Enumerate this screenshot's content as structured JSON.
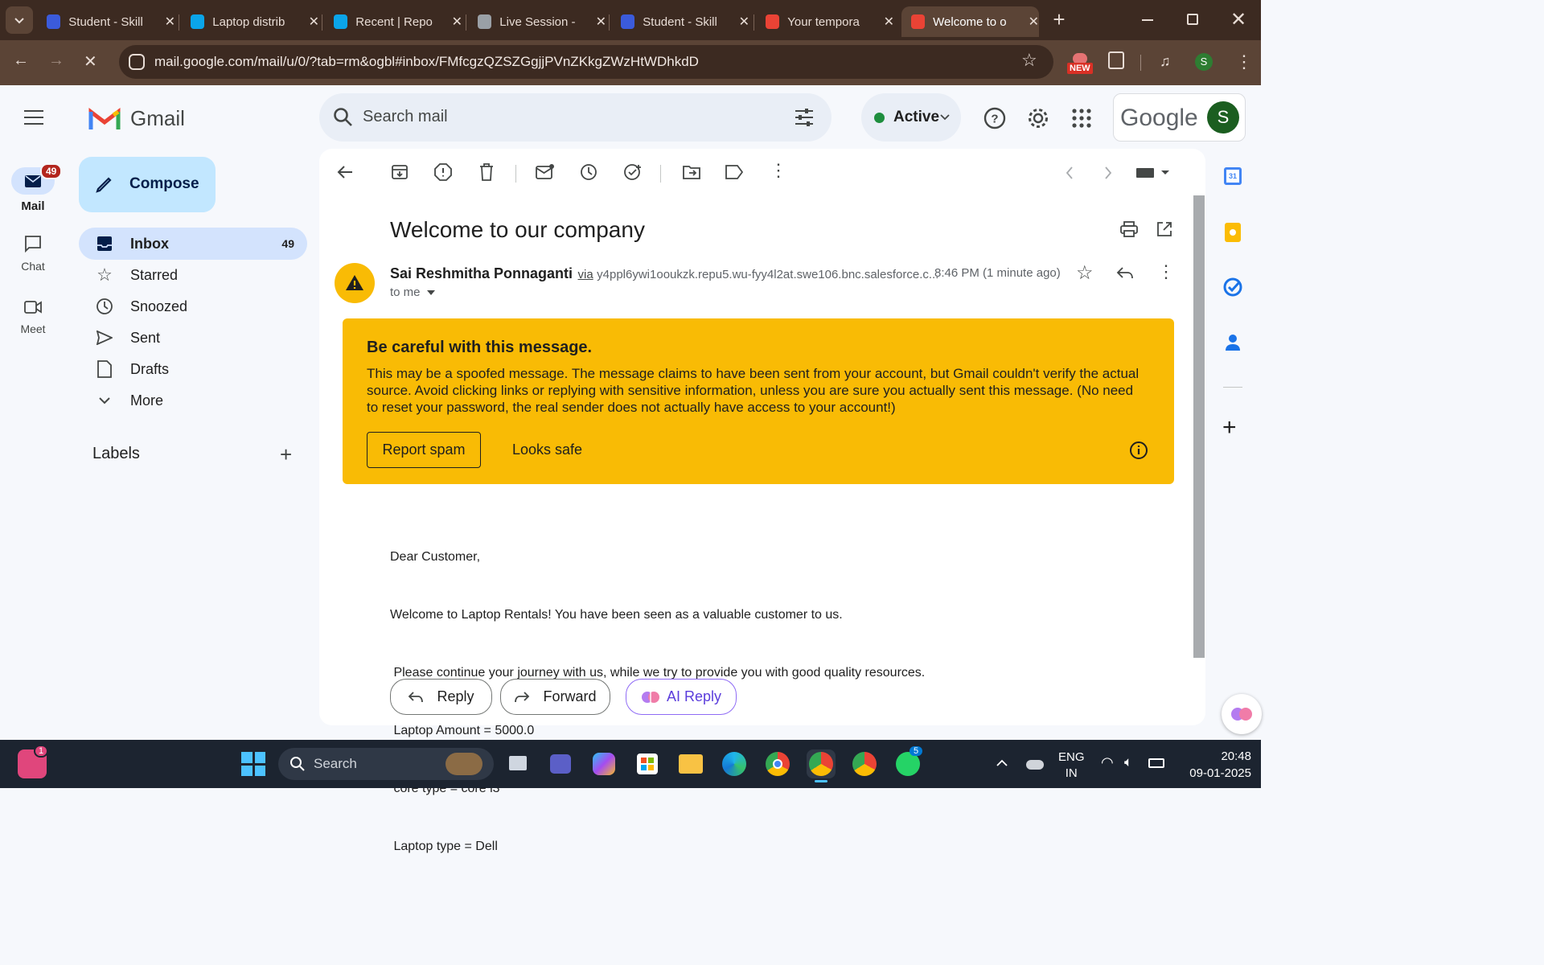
{
  "browser": {
    "tabs": [
      {
        "title": "Student - Skill",
        "color": "#3b5bdb"
      },
      {
        "title": "Laptop distrib",
        "color": "#0ba5e9"
      },
      {
        "title": "Recent | Repo",
        "color": "#0ba5e9"
      },
      {
        "title": "Live Session -",
        "color": "#9aa0a6"
      },
      {
        "title": "Student - Skill",
        "color": "#3b5bdb"
      },
      {
        "title": "Your tempora",
        "color": "#ea4335"
      },
      {
        "title": "Welcome to o",
        "color": "#ea4335"
      }
    ],
    "url": "mail.google.com/mail/u/0/?tab=rm&ogbl#inbox/FMfcgzQZSZGgjjPVnZKkgZWzHtWDhkdD",
    "ext_badge": "NEW",
    "profile_initial": "S"
  },
  "gmail": {
    "logo_text": "Gmail",
    "search_placeholder": "Search mail",
    "status": "Active",
    "google_text": "Google",
    "avatar_initial": "S",
    "rail": [
      {
        "label": "Mail",
        "badge": "49"
      },
      {
        "label": "Chat"
      },
      {
        "label": "Meet"
      }
    ],
    "compose": "Compose",
    "nav": [
      {
        "label": "Inbox",
        "count": "49"
      },
      {
        "label": "Starred"
      },
      {
        "label": "Snoozed"
      },
      {
        "label": "Sent"
      },
      {
        "label": "Drafts"
      },
      {
        "label": "More"
      }
    ],
    "labels_heading": "Labels"
  },
  "email": {
    "subject": "Welcome to our company",
    "sender": "Sai Reshmitha Ponnaganti",
    "via": "via",
    "via_address": "y4ppl6ywi1ooukzk.repu5.wu-fyy4l2at.swe106.bnc.salesforce.c...",
    "time": "8:46 PM (1 minute ago)",
    "to": "to me",
    "warning": {
      "title": "Be careful with this message.",
      "body": "This may be a spoofed message. The message claims to have been sent from your account, but Gmail couldn't verify the actual source. Avoid clicking links or replying with sensitive information, unless you are sure you actually sent this message. (No need to reset your password, the real sender does not actually have access to your account!)",
      "report": "Report spam",
      "safe": "Looks safe"
    },
    "body": [
      "Dear Customer,",
      "Welcome to Laptop Rentals! You have been seen as a valuable customer to us.",
      " Please continue your journey with us, while we try to provide you with good quality resources.",
      " Laptop Amount = 5000.0",
      " core type = core i3",
      " Laptop type = Dell"
    ],
    "reply": "Reply",
    "forward": "Forward",
    "ai_reply": "AI Reply"
  },
  "taskbar": {
    "search": "Search",
    "lang1": "ENG",
    "lang2": "IN",
    "time": "20:48",
    "date": "09-01-2025",
    "notif_badge": "1",
    "whatsapp_badge": "5"
  }
}
